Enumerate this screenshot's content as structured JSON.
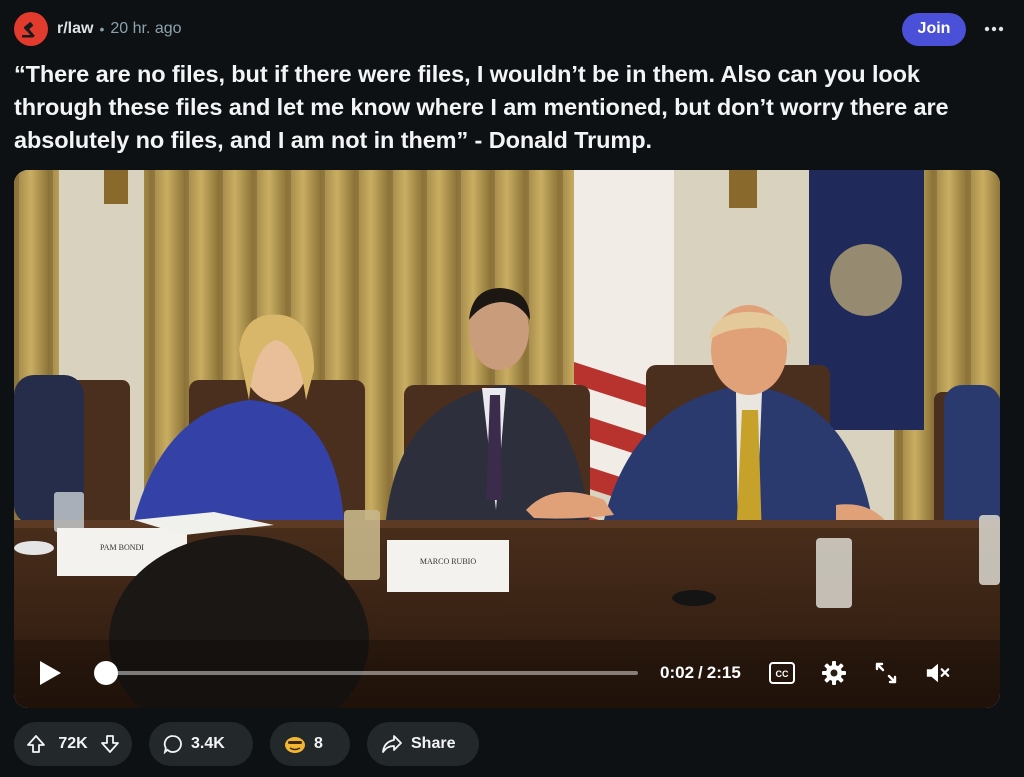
{
  "post": {
    "subreddit": "r/law",
    "separator": "•",
    "time_ago": "20 hr. ago",
    "join_label": "Join",
    "more_icon": "more-dots-icon",
    "title": "“There are no files, but if there were files, I wouldn’t be in them. Also can you look through these files and let me know where I am mentioned, but don’t worry there are absolutely no files, and I am not in them” - Donald Trump."
  },
  "video": {
    "nameplates": [
      "PAM BONDI",
      "MARCO RUBIO"
    ],
    "current_time": "0:02",
    "time_separator": "/",
    "total_time": "2:15",
    "progress_fraction": 0.015,
    "cc_label": "CC",
    "icons": [
      "play-icon",
      "captions-icon",
      "settings-gear-icon",
      "expand-icon",
      "mute-icon"
    ]
  },
  "actions": {
    "upvote_count": "72K",
    "comment_count": "3.4K",
    "award_count": "8",
    "share_label": "Share"
  },
  "colors": {
    "background": "#0e1113",
    "join_button": "#4a50d8",
    "subreddit_avatar": "#e23b2e",
    "pill": "#23282b"
  }
}
